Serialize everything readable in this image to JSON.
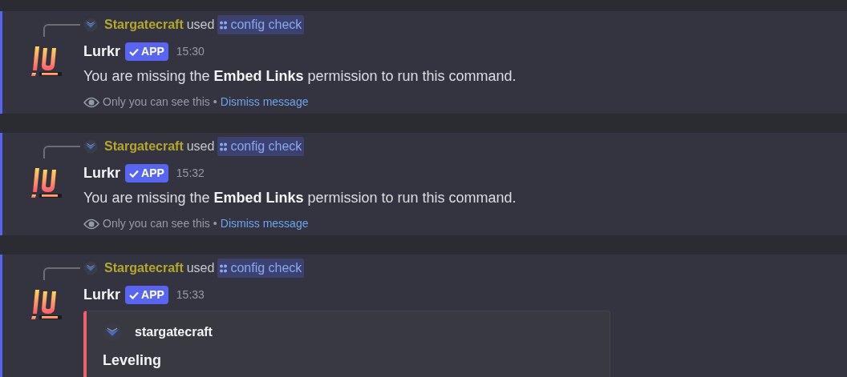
{
  "messages": [
    {
      "kind": "text",
      "reply": {
        "user": "Stargatecraft",
        "verb": "used",
        "command": "config check"
      },
      "author": "Lurkr",
      "badge": "APP",
      "time": "15:30",
      "content": "You are missing the **Embed Links** permission to run this command.",
      "note": {
        "text": "Only you can see this",
        "separator": "•",
        "link": "Dismiss message"
      }
    },
    {
      "kind": "text",
      "reply": {
        "user": "Stargatecraft",
        "verb": "used",
        "command": "config check"
      },
      "author": "Lurkr",
      "badge": "APP",
      "time": "15:32",
      "content": "You are missing the **Embed Links** permission to run this command.",
      "note": {
        "text": "Only you can see this",
        "separator": "•",
        "link": "Dismiss message"
      }
    },
    {
      "kind": "embed",
      "reply": {
        "user": "Stargatecraft",
        "verb": "used",
        "command": "config check"
      },
      "author": "Lurkr",
      "badge": "APP",
      "time": "15:33",
      "embed": {
        "author": "stargatecraft",
        "title": "Leveling",
        "color": "#f0616b"
      }
    }
  ]
}
